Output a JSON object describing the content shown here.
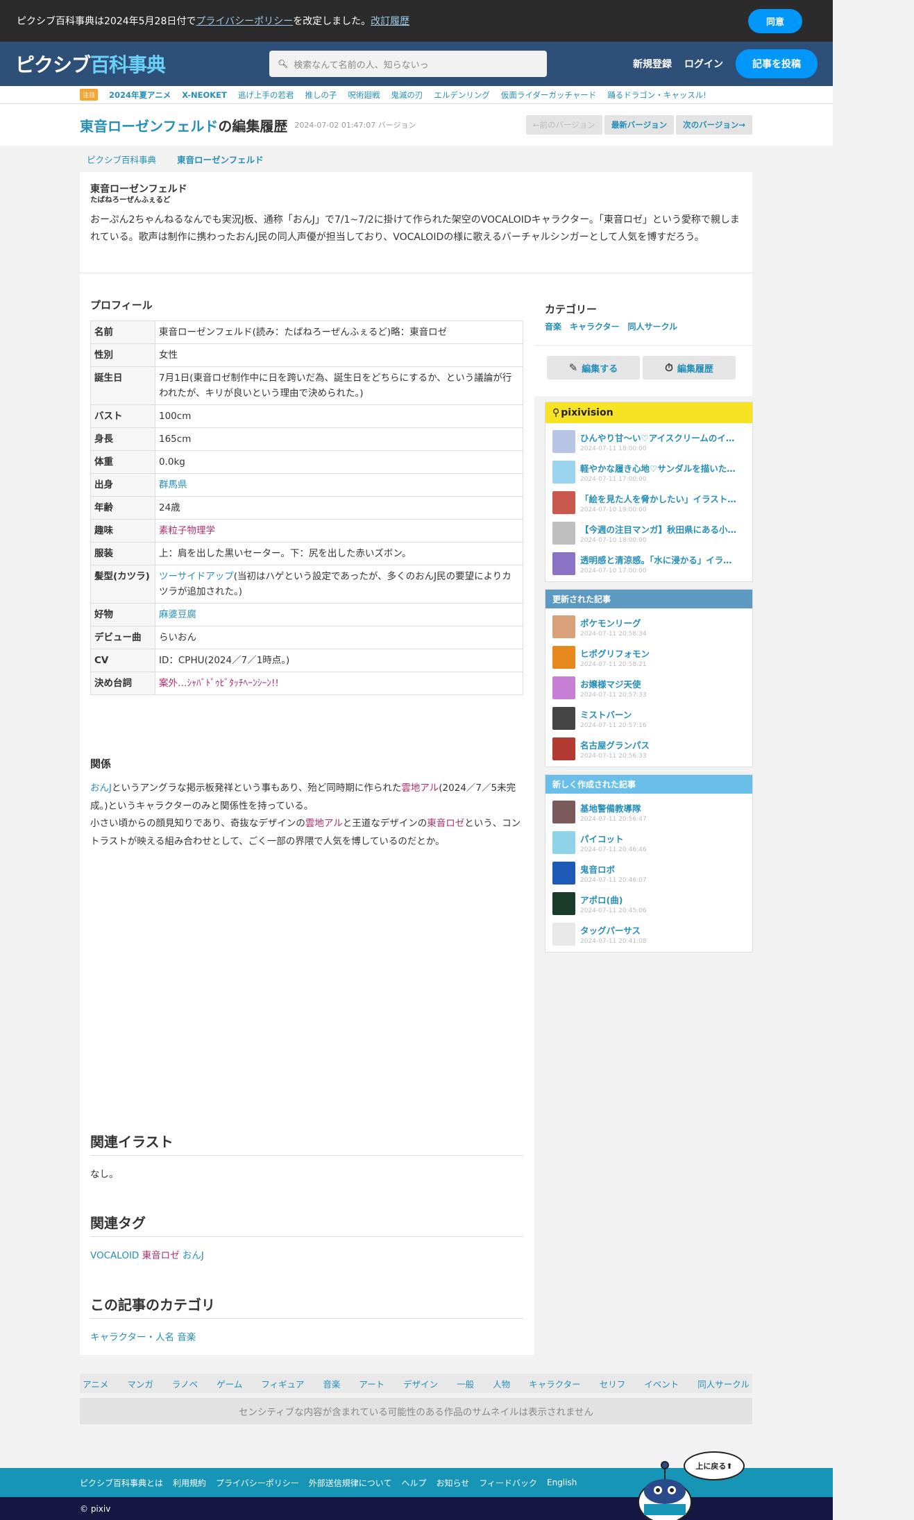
{
  "notice": {
    "prefix": "ピクシブ百科事典は2024年5月28日付で",
    "policy_link": "プライバシーポリシー",
    "suffix": "を改定しました。",
    "history_link": "改訂履歴",
    "agree": "同意"
  },
  "header": {
    "logo_a": "ピクシブ",
    "logo_b": "百科事典",
    "search_placeholder": "検索なんて名前の人、知らないっ",
    "register": "新規登録",
    "login": "ログイン",
    "post": "記事を投稿"
  },
  "trend": {
    "badge": "注目",
    "items": [
      "2024年夏アニメ",
      "X-NEOKET",
      "逃げ上手の若君",
      "推しの子",
      "呪術廻戦",
      "鬼滅の刃",
      "エルデンリング",
      "仮面ライダーガッチャード",
      "踊るドラゴン・キャッスル!"
    ]
  },
  "title": {
    "subject": "東音ローゼンフェルド",
    "suffix": "の編集履歴",
    "version": "2024-07-02 01:47:07 バージョン",
    "prev": "←前のバージョン",
    "latest": "最新バージョン",
    "next": "次のバージョン→"
  },
  "breadcrumb": {
    "root": "ピクシブ百科事典",
    "current": "東音ローゼンフェルド"
  },
  "summary": {
    "name": "東音ローゼンフェルド",
    "kana": "たばねろーぜんふぇるど",
    "text": "おーぷん2ちゃんねるなんでも実況J板、通称「おんJ」で7/1~7/2に掛けて作られた架空のVOCALOIDキャラクター。「東音ロゼ」という愛称で親しまれている。歌声は制作に携わったおんJ民の同人声優が担当しており、VOCALOIDの様に歌えるバーチャルシンガーとして人気を博すだろう。"
  },
  "profile": {
    "heading": "プロフィール",
    "rows": [
      {
        "k": "名前",
        "v": "東音ローゼンフェルド(読み：たばねろーぜんふぇるど)略：東音ロゼ"
      },
      {
        "k": "性別",
        "v": "女性"
      },
      {
        "k": "誕生日",
        "v": "7月1日(東音ロゼ制作中に日を跨いだ為、誕生日をどちらにするか、という議論が行われたが、キリが良いという理由で決められた。)"
      },
      {
        "k": "バスト",
        "v": "100cm"
      },
      {
        "k": "身長",
        "v": "165cm"
      },
      {
        "k": "体重",
        "v": "0.0kg"
      },
      {
        "k": "出身",
        "v": "群馬県",
        "link": "blue"
      },
      {
        "k": "年齢",
        "v": "24歳"
      },
      {
        "k": "趣味",
        "v": "素粒子物理学",
        "link": "pink"
      },
      {
        "k": "服装",
        "v": "上：肩を出した黒いセーター。下：尻を出した赤いズボン。"
      },
      {
        "k": "髪型(カツラ)",
        "v_link": "ツーサイドアップ",
        "v": "(当初はハゲという設定であったが、多くのおんJ民の要望によりカツラが追加された。)"
      },
      {
        "k": "好物",
        "v": "麻婆豆腐",
        "link": "blue"
      },
      {
        "k": "デビュー曲",
        "v": "らいおん"
      },
      {
        "k": "CV",
        "v": "ID：CPHU(2024／7／1時点。)"
      },
      {
        "k": "決め台詞",
        "v": "案外…ｼｬﾊﾞﾄﾞｩﾋﾞﾀｯﾁﾍｰﾝｼｰﾝ!!",
        "link": "pink"
      }
    ]
  },
  "relation": {
    "heading": "関係",
    "l1_link": "おんJ",
    "l1_a": "というアングラな掲示板発祥という事もあり、殆ど同時期に作られた",
    "l1_link2": "雲地アル",
    "l1_b": "(2024／7／5未完成。)というキャラクターのみと関係性を持っている。",
    "l2_a": "小さい頃からの顔見知りであり、奇抜なデザインの",
    "l2_link": "雲地アル",
    "l2_b": "と王道なデザインの",
    "l2_link2": "東音ロゼ",
    "l2_c": "という、コントラストが映える組み合わせとして、ごく一部の界隈で人気を博しているのだとか。"
  },
  "related_illust": {
    "heading": "関連イラスト",
    "text": "なし。"
  },
  "related_tags": {
    "heading": "関連タグ",
    "t1": "VOCALOID",
    "t2": "東音ロゼ",
    "t3": "おんJ"
  },
  "article_cats": {
    "heading": "この記事のカテゴリ",
    "c1": "キャラクター・人名",
    "c2": "音楽"
  },
  "sidebar": {
    "cat_heading": "カテゴリー",
    "cats": [
      "音楽",
      "キャラクター",
      "同人サークル"
    ],
    "edit": "編集する",
    "history": "編集履歴",
    "pixivision_title": "pixivision",
    "pixivision": [
      {
        "t": "ひんやり甘〜い♡アイスクリームのイラスト特集",
        "d": "2024-07-11 18:00:00",
        "c": "#b8c6e6"
      },
      {
        "t": "軽やかな履き心地♡サンダルを描いたイラスト特集",
        "d": "2024-07-11 17:00:00",
        "c": "#9ad4ef"
      },
      {
        "t": "「絵を見た人を脅かしたい」イラストレーター",
        "d": "2024-07-10 19:00:00",
        "c": "#c9584d"
      },
      {
        "t": "【今週の注目マンガ】秋田県にある小さな町",
        "d": "2024-07-10 18:00:00",
        "c": "#bfbfbf"
      },
      {
        "t": "透明感と清涼感。「水に浸かる」イラスト特集",
        "d": "2024-07-10 17:00:00",
        "c": "#8a73c4"
      }
    ],
    "updated_title": "更新された記事",
    "updated": [
      {
        "t": "ポケモンリーグ",
        "d": "2024-07-11 20:58:34",
        "c": "#d9a07a"
      },
      {
        "t": "ヒポグリフォモン",
        "d": "2024-07-11 20:58:21",
        "c": "#e6881c"
      },
      {
        "t": "お嬢様マジ天使",
        "d": "2024-07-11 20:57:33",
        "c": "#c77fd6"
      },
      {
        "t": "ミストバーン",
        "d": "2024-07-11 20:57:16",
        "c": "#444444"
      },
      {
        "t": "名古屋グランパス",
        "d": "2024-07-11 20:56:33",
        "c": "#b23a30"
      }
    ],
    "new_title": "新しく作成された記事",
    "new": [
      {
        "t": "基地警備教導隊",
        "d": "2024-07-11 20:56:47",
        "c": "#7a5a5a"
      },
      {
        "t": "パイコット",
        "d": "2024-07-11 20:46:46",
        "c": "#8fd3e8"
      },
      {
        "t": "鬼音ロボ",
        "d": "2024-07-11 20:46:07",
        "c": "#1e59b8"
      },
      {
        "t": "アポロ(曲)",
        "d": "2024-07-11 20:45:06",
        "c": "#1a3a2a"
      },
      {
        "t": "タッグパーサス",
        "d": "2024-07-11 20:41:08",
        "c": "#e8e8e8"
      }
    ]
  },
  "footnav": [
    "アニメ",
    "マンガ",
    "ラノベ",
    "ゲーム",
    "フィギュア",
    "音楽",
    "アート",
    "デザイン",
    "一般",
    "人物",
    "キャラクター",
    "セリフ",
    "イベント",
    "同人サークル"
  ],
  "sensitive": "センシティブな内容が含まれている可能性のある作品のサムネイルは表示されません",
  "footer": {
    "links": [
      "ピクシブ百科事典とは",
      "利用規約",
      "プライバシーポリシー",
      "外部送信規律について",
      "ヘルプ",
      "お知らせ",
      "フィードバック",
      "English"
    ],
    "copyright": "© pixiv",
    "totop": "上に戻る⬆"
  }
}
